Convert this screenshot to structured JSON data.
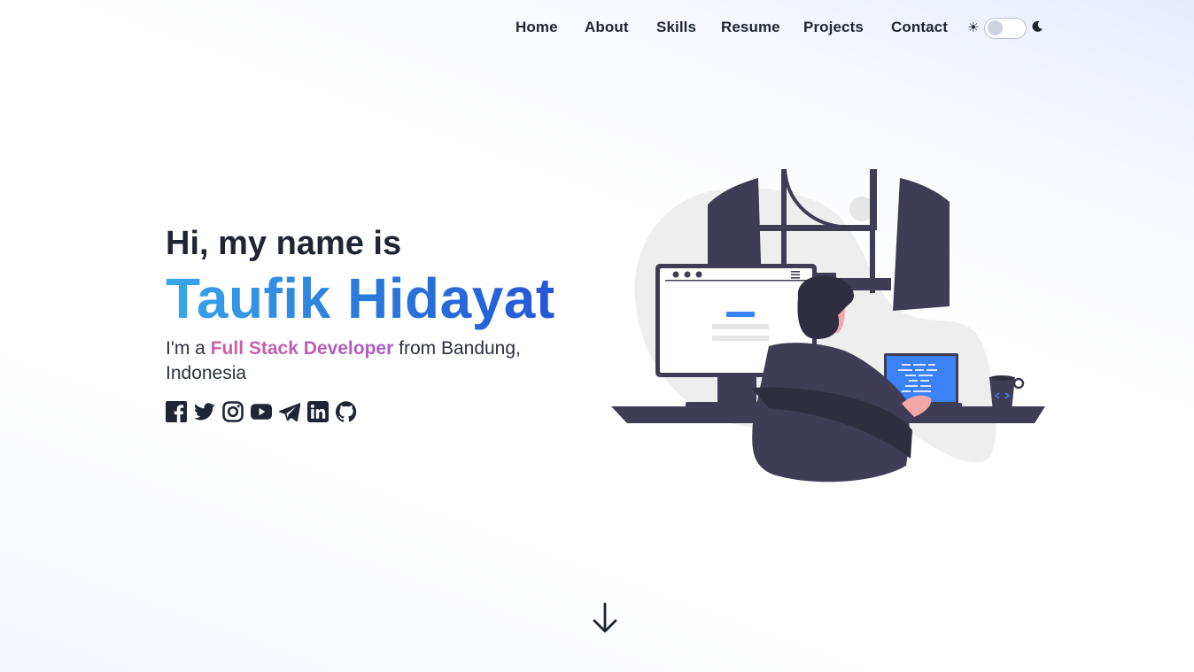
{
  "nav": {
    "links": [
      "Home",
      "About",
      "Skills",
      "Resume",
      "Projects",
      "Contact"
    ],
    "theme_toggle": {
      "light_icon": "sun-icon",
      "dark_icon": "moon-icon",
      "state": "light"
    }
  },
  "hero": {
    "greeting": "Hi, my name is",
    "name": "Taufik Hidayat",
    "intro_prefix": "I'm a",
    "role": "Full Stack Developer",
    "intro_suffix": "from Bandung, Indonesia"
  },
  "socials": [
    "facebook-icon",
    "twitter-icon",
    "instagram-icon",
    "youtube-icon",
    "telegram-icon",
    "linkedin-icon",
    "github-icon"
  ],
  "scroll_icon": "arrow-down-icon",
  "colors": {
    "text": "#1f2533",
    "name_gradient": [
      "#38a7ec",
      "#2456d9"
    ],
    "role_gradient": [
      "#cf5fa0",
      "#a85cc8"
    ],
    "illustration_dark": "#3f3d56",
    "illustration_accent": "#3b82f6"
  }
}
